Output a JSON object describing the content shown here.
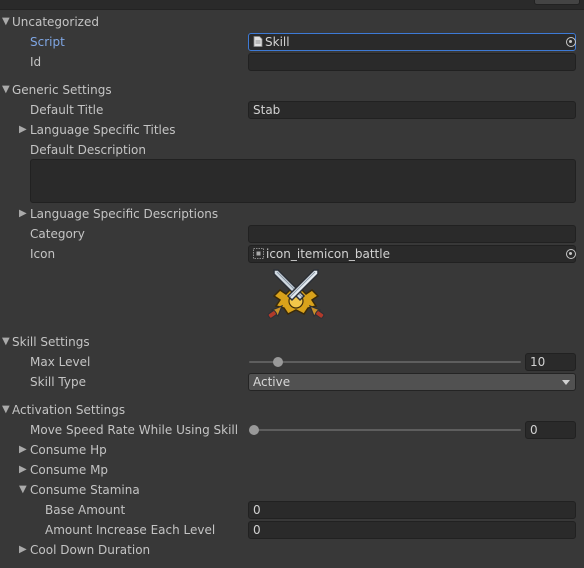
{
  "sections": {
    "uncategorized": "Uncategorized",
    "generic": "Generic Settings",
    "skill": "Skill Settings",
    "activation": "Activation Settings"
  },
  "uncategorized": {
    "script_label": "Script",
    "script_value": "Skill",
    "id_label": "Id",
    "id_value": ""
  },
  "generic": {
    "default_title_label": "Default Title",
    "default_title_value": "Stab",
    "language_titles_label": "Language Specific Titles",
    "default_description_label": "Default Description",
    "default_description_value": "",
    "language_descriptions_label": "Language Specific Descriptions",
    "category_label": "Category",
    "category_value": "",
    "icon_label": "Icon",
    "icon_value": "icon_itemicon_battle"
  },
  "skill": {
    "max_level_label": "Max Level",
    "max_level_value": "10",
    "max_level_fraction": 0.09,
    "skill_type_label": "Skill Type",
    "skill_type_value": "Active"
  },
  "activation": {
    "move_speed_label": "Move Speed Rate While Using Skill",
    "move_speed_value": "0",
    "move_speed_fraction": 0,
    "consume_hp_label": "Consume Hp",
    "consume_mp_label": "Consume Mp",
    "consume_stamina_label": "Consume Stamina",
    "base_amount_label": "Base Amount",
    "base_amount_value": "0",
    "amount_increase_label": "Amount Increase Each Level",
    "amount_increase_value": "0",
    "cool_down_label": "Cool Down Duration"
  },
  "icons": {
    "collapsed": "▶",
    "expanded": "▼"
  }
}
